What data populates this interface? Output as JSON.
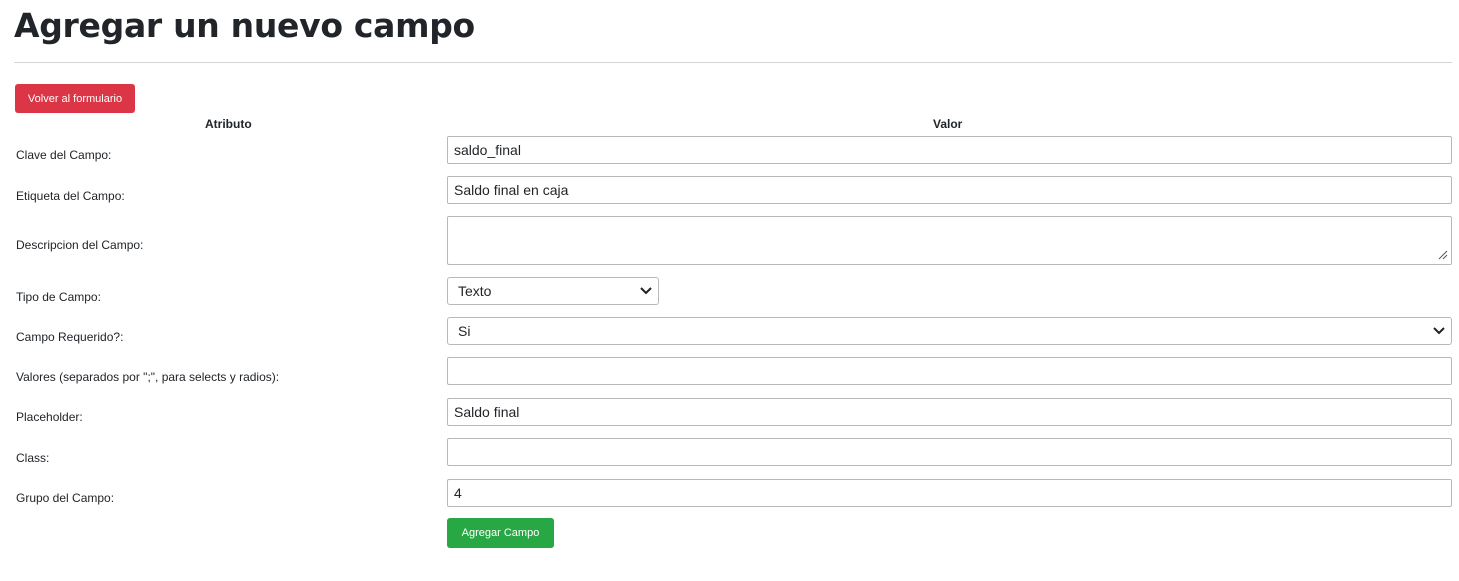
{
  "page": {
    "title": "Agregar un nuevo campo"
  },
  "actions": {
    "back_label": "Volver al formulario",
    "submit_label": "Agregar Campo"
  },
  "table": {
    "headers": [
      "Atributo",
      "Valor"
    ],
    "rows": [
      {
        "label": "Clave del Campo:",
        "value": "saldo_final"
      },
      {
        "label": "Etiqueta del Campo:",
        "value": "Saldo final en caja"
      },
      {
        "label": "Descripcion del Campo:",
        "value": ""
      },
      {
        "label": "Tipo de Campo:",
        "value": "Texto"
      },
      {
        "label": "Campo Requerido?:",
        "value": "Si"
      },
      {
        "label": "Valores (separados por \";\", para selects y radios):",
        "value": ""
      },
      {
        "label": "Placeholder:",
        "value": "Saldo final"
      },
      {
        "label": "Class:",
        "value": ""
      },
      {
        "label": "Grupo del Campo:",
        "value": "4"
      }
    ]
  },
  "icons": {
    "select_arrow": "chevron-down-icon",
    "textarea_grip": "resize-grip-icon"
  },
  "colors": {
    "danger": "#dc3545",
    "success": "#28a745",
    "border": "#b8b8b8"
  }
}
